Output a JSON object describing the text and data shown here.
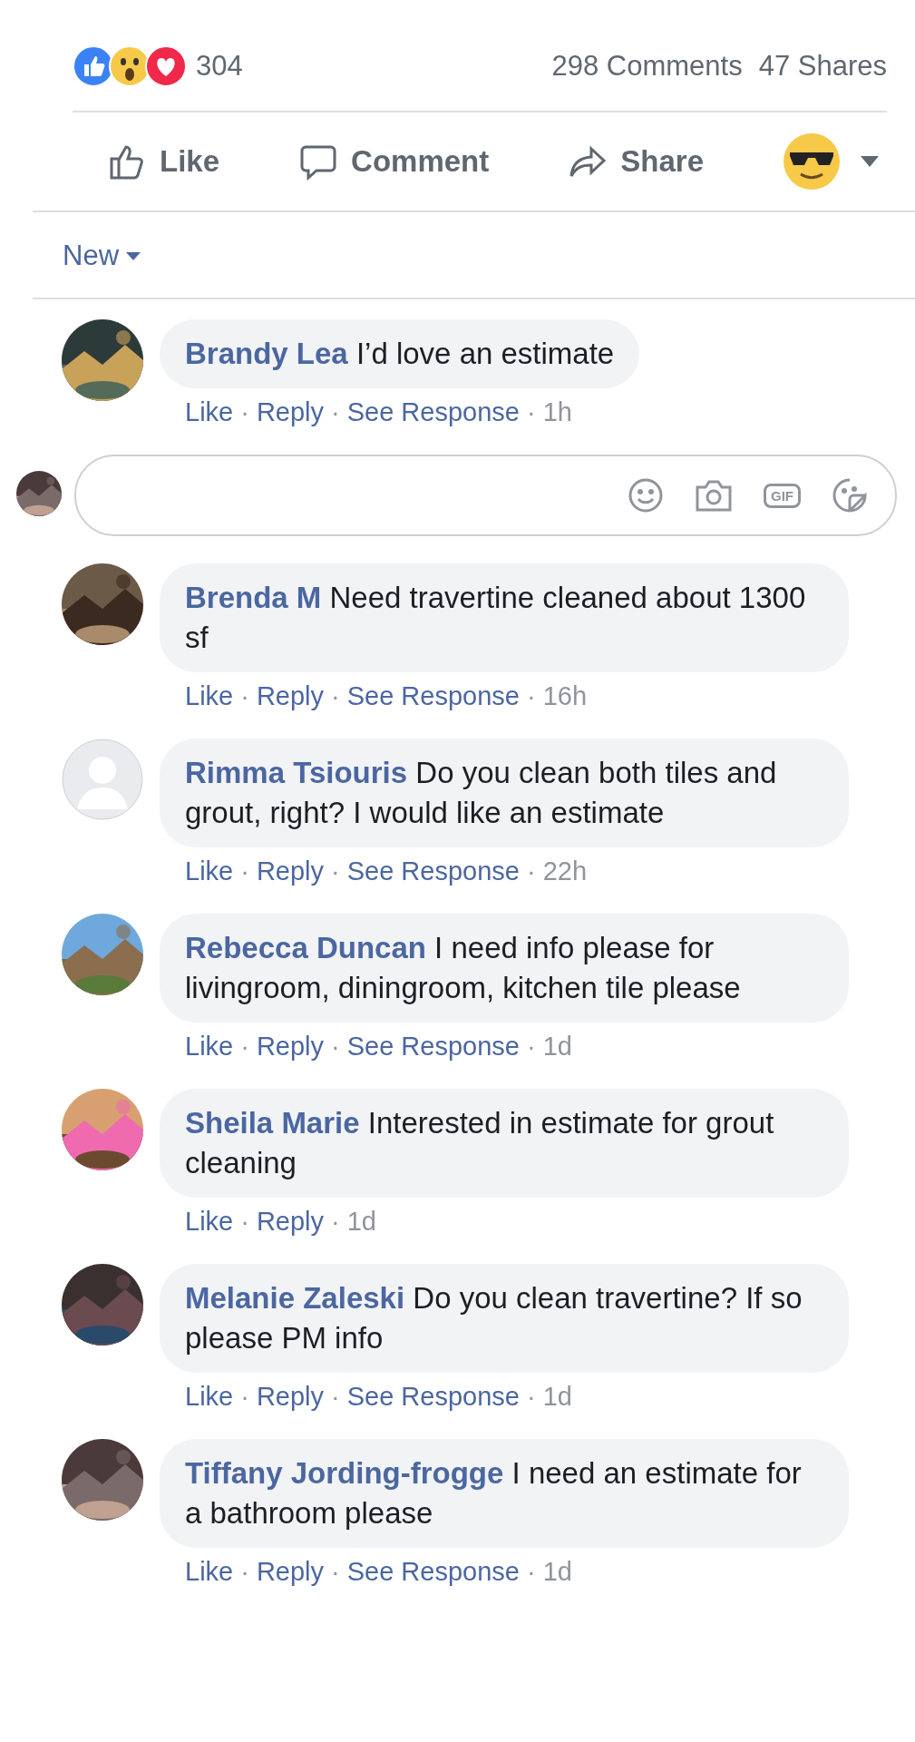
{
  "summary": {
    "reaction_count": "304",
    "comments": "298 Comments",
    "shares": "47 Shares"
  },
  "actions": [
    {
      "kind": "like",
      "label": "Like"
    },
    {
      "kind": "comment",
      "label": "Comment"
    },
    {
      "kind": "share",
      "label": "Share"
    }
  ],
  "sort": {
    "label": "New"
  },
  "separator": "·",
  "comments": [
    {
      "name": "Brandy Lea",
      "text": "I’d love an estimate",
      "kind": "picture",
      "links": [
        "Like",
        "Reply",
        "See Response"
      ],
      "time": "1h",
      "reply_box": {
        "gif_label": "GIF"
      }
    },
    {
      "name": "Brenda M",
      "text": "Need travertine cleaned about 1300 sf",
      "kind": "picture",
      "links": [
        "Like",
        "Reply",
        "See Response"
      ],
      "time": "16h"
    },
    {
      "name": "Rimma Tsiouris",
      "text": "Do you clean both tiles and grout, right? I would like an estimate",
      "kind": "default",
      "links": [
        "Like",
        "Reply",
        "See Response"
      ],
      "time": "22h"
    },
    {
      "name": "Rebecca Duncan",
      "text": "I need info please for livingroom, diningroom, kitchen tile please",
      "kind": "picture",
      "links": [
        "Like",
        "Reply",
        "See Response"
      ],
      "time": "1d"
    },
    {
      "name": "Sheila Marie",
      "text": "Interested in estimate for grout cleaning",
      "kind": "picture",
      "links": [
        "Like",
        "Reply"
      ],
      "time": "1d"
    },
    {
      "name": "Melanie Zaleski",
      "text": "Do you clean travertine? If so please PM info",
      "kind": "picture",
      "links": [
        "Like",
        "Reply",
        "See Response"
      ],
      "time": "1d"
    },
    {
      "name": "Tiffany Jording-frogge",
      "text": "I need an estimate for a bathroom please",
      "kind": "picture",
      "links": [
        "Like",
        "Reply",
        "See Response"
      ],
      "time": "1d"
    }
  ]
}
